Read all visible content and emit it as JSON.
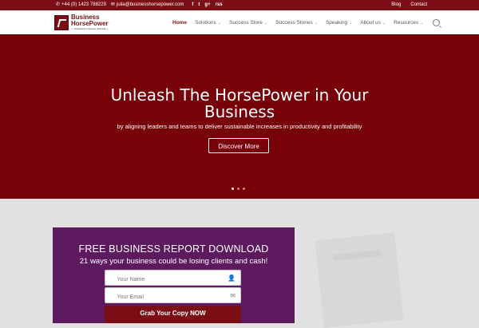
{
  "topbar": {
    "phone": "+44 (0) 1423 788229",
    "email": "julia@businesshorsepower.com",
    "social": [
      "f",
      "t",
      "g+",
      "rss"
    ],
    "links": [
      "Blog",
      "Contact"
    ]
  },
  "header": {
    "logo": {
      "line1": "Business",
      "line2": "HorsePower",
      "tagline": "— unleashing business potential —"
    },
    "nav": [
      {
        "label": "Home"
      },
      {
        "label": "Solutions"
      },
      {
        "label": "Success Store"
      },
      {
        "label": "Success Stories"
      },
      {
        "label": "Speaking"
      },
      {
        "label": "About us"
      },
      {
        "label": "Resources"
      }
    ]
  },
  "hero": {
    "title_line1": "Unleash The HorsePower in Your",
    "title_line2": "Business",
    "subtitle": "by aligning leaders and teams to deliver sustainable increases in productivity and profitability",
    "button": "Discover More",
    "slides": 3
  },
  "optin": {
    "title": "FREE BUSINESS REPORT DOWNLOAD",
    "subtitle": "21 ways your business could be losing clients and cash!",
    "name_placeholder": "Your Name",
    "email_placeholder": "Your Email",
    "cta": "Grab Your Copy NOW"
  },
  "colors": {
    "brand": "#7b0e14",
    "hero": "#770009",
    "panel": "#5e1a5f"
  }
}
